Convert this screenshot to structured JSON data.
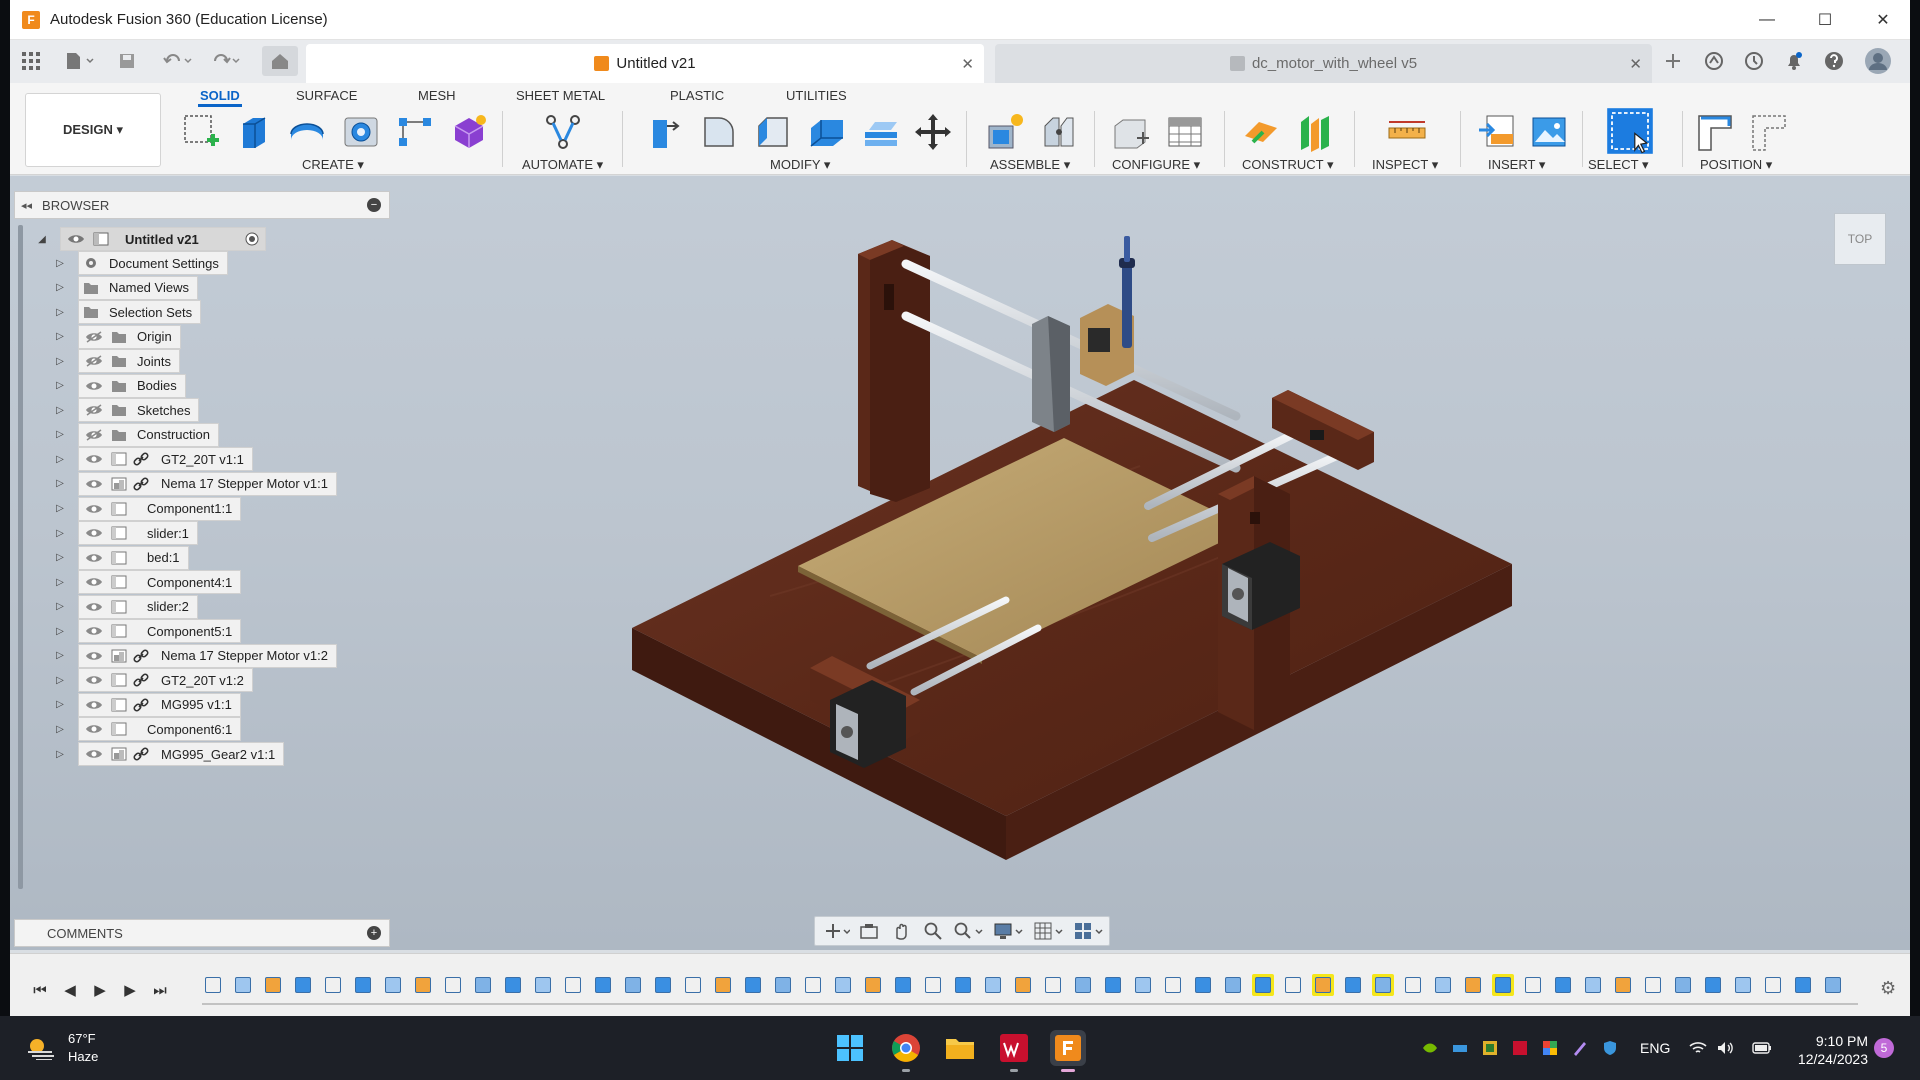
{
  "window": {
    "title": "Autodesk Fusion 360 (Education License)",
    "minimize": "—",
    "maximize": "☐",
    "close": "✕"
  },
  "tabs": {
    "active_label": "Untitled v21",
    "inactive_label": "dc_motor_with_wheel v5",
    "close_glyph": "✕"
  },
  "toolbar": {
    "design_label": "DESIGN ▾",
    "workspace_tabs": [
      "SOLID",
      "SURFACE",
      "MESH",
      "SHEET METAL",
      "PLASTIC",
      "UTILITIES"
    ],
    "groups": [
      "CREATE ▾",
      "AUTOMATE ▾",
      "MODIFY ▾",
      "ASSEMBLE ▾",
      "CONFIGURE ▾",
      "CONSTRUCT ▾",
      "INSPECT ▾",
      "INSERT ▾",
      "SELECT ▾",
      "POSITION ▾"
    ]
  },
  "browser": {
    "title": "BROWSER",
    "collapse_glyph": "◂◂",
    "minus_glyph": "−",
    "root": "Untitled v21",
    "items": [
      {
        "label": "Document Settings",
        "type": "settings"
      },
      {
        "label": "Named Views",
        "type": "folder"
      },
      {
        "label": "Selection Sets",
        "type": "folder"
      },
      {
        "label": "Origin",
        "type": "folder-hidden"
      },
      {
        "label": "Joints",
        "type": "folder-hidden"
      },
      {
        "label": "Bodies",
        "type": "folder"
      },
      {
        "label": "Sketches",
        "type": "folder-hidden"
      },
      {
        "label": "Construction",
        "type": "folder-hidden"
      },
      {
        "label": "GT2_20T v1:1",
        "type": "linked"
      },
      {
        "label": "Nema 17 Stepper Motor v1:1",
        "type": "linked-asm"
      },
      {
        "label": "Component1:1",
        "type": "component"
      },
      {
        "label": "slider:1",
        "type": "component"
      },
      {
        "label": "bed:1",
        "type": "component"
      },
      {
        "label": "Component4:1",
        "type": "component"
      },
      {
        "label": "slider:2",
        "type": "component"
      },
      {
        "label": "Component5:1",
        "type": "component"
      },
      {
        "label": "Nema 17 Stepper Motor v1:2",
        "type": "linked-asm"
      },
      {
        "label": "GT2_20T v1:2",
        "type": "linked"
      },
      {
        "label": "MG995 v1:1",
        "type": "linked"
      },
      {
        "label": "Component6:1",
        "type": "component"
      },
      {
        "label": "MG995_Gear2 v1:1",
        "type": "linked-asm"
      }
    ]
  },
  "comments": {
    "title": "COMMENTS",
    "plus_glyph": "+"
  },
  "viewcube": {
    "face": "TOP"
  },
  "timeline": {
    "controls": [
      "⏮",
      "◀",
      "▶",
      "▶",
      "⏭"
    ],
    "gear_glyph": "⚙"
  },
  "taskbar": {
    "temperature": "67°F",
    "condition": "Haze",
    "language": "ENG",
    "time": "9:10 PM",
    "date": "12/24/2023",
    "notifications": "5"
  },
  "colors": {
    "accent": "#0a64c8",
    "fusion_orange": "#f08a1c",
    "wood_dark": "#5b2a1a",
    "bed_tan": "#b39863",
    "timeline_highlight": "#f5e61a"
  }
}
